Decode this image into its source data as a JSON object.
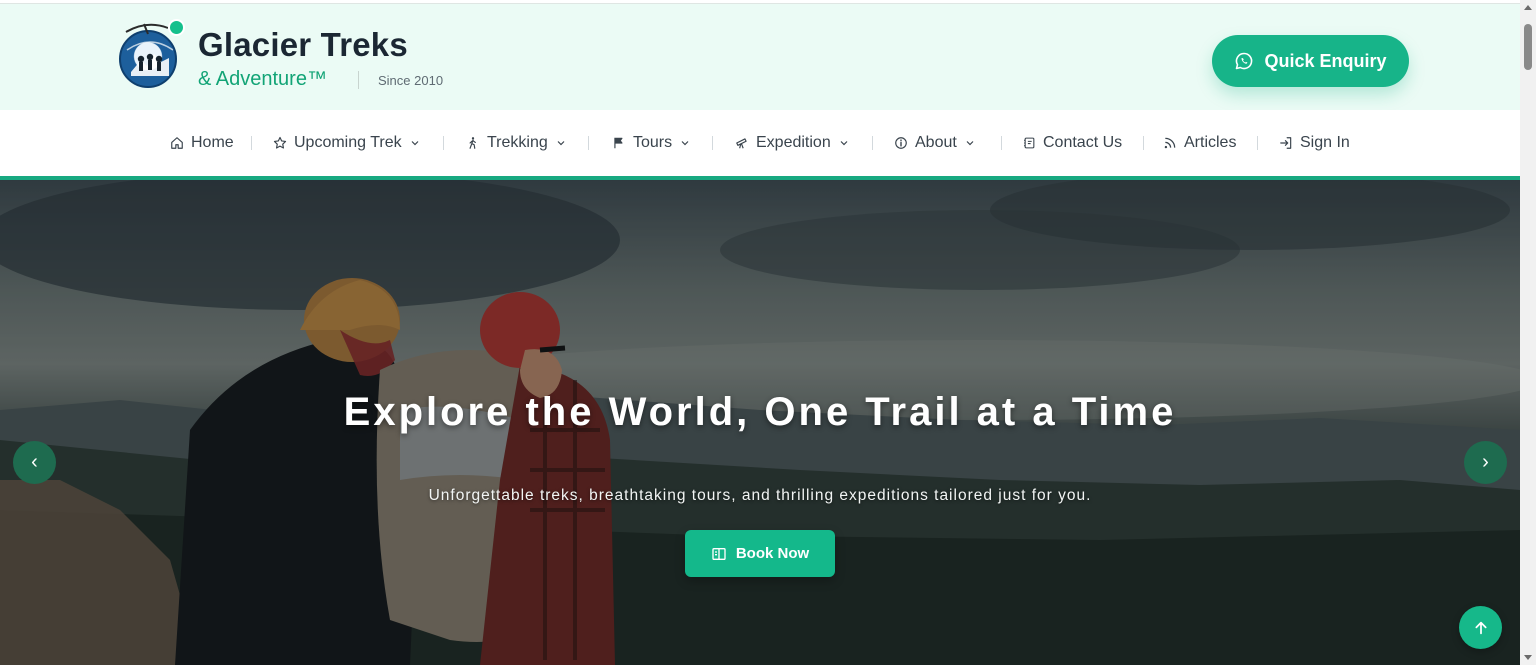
{
  "brand": {
    "name": "Glacier Treks",
    "tagline": "& Adventure™",
    "since": "Since 2010"
  },
  "header": {
    "enquiry_label": "Quick Enquiry"
  },
  "nav": {
    "items": [
      {
        "label": "Home",
        "icon": "home-icon",
        "dropdown": false
      },
      {
        "label": "Upcoming Trek",
        "icon": "star-icon",
        "dropdown": true
      },
      {
        "label": "Trekking",
        "icon": "hiker-icon",
        "dropdown": true
      },
      {
        "label": "Tours",
        "icon": "flag-icon",
        "dropdown": true
      },
      {
        "label": "Expedition",
        "icon": "telescope-icon",
        "dropdown": true
      },
      {
        "label": "About",
        "icon": "info-icon",
        "dropdown": true
      },
      {
        "label": "Contact Us",
        "icon": "contact-card-icon",
        "dropdown": false
      },
      {
        "label": "Articles",
        "icon": "rss-icon",
        "dropdown": false
      },
      {
        "label": "Sign In",
        "icon": "sign-in-icon",
        "dropdown": false
      }
    ]
  },
  "hero": {
    "title": "Explore the World, One Trail at a Time",
    "subtitle": "Unforgettable treks, breathtaking tours, and thrilling expeditions tailored just for you.",
    "cta_label": "Book Now",
    "prev_label": "‹",
    "next_label": "›"
  },
  "colors": {
    "accent": "#17b489",
    "header_bg": "#ebfbf5",
    "brand_dark": "#1b2733",
    "brand_green": "#12a476",
    "slider_arrow": "#1e6b4f"
  }
}
